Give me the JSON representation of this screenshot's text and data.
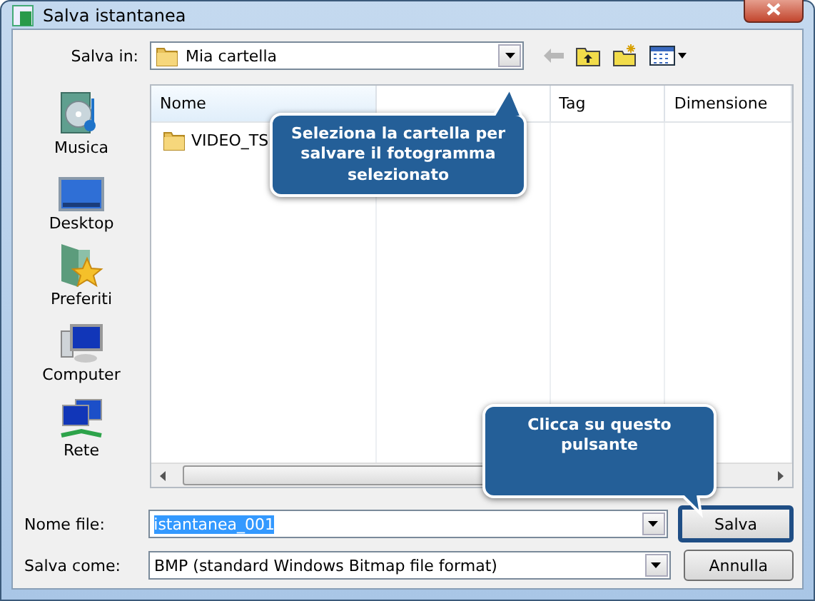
{
  "window": {
    "title": "Salva istantanea"
  },
  "save_in": {
    "label": "Salva in:",
    "value": "Mia cartella"
  },
  "places": [
    {
      "label": "Musica",
      "kind": "music"
    },
    {
      "label": "Desktop",
      "kind": "desktop"
    },
    {
      "label": "Preferiti",
      "kind": "favorites"
    },
    {
      "label": "Computer",
      "kind": "computer"
    },
    {
      "label": "Rete",
      "kind": "network"
    }
  ],
  "table": {
    "columns": [
      "Nome",
      "",
      "Tag",
      "Dimensione"
    ],
    "rows": [
      {
        "name": "VIDEO_TS",
        "selected": false
      }
    ]
  },
  "file_name": {
    "label": "Nome file:",
    "value": "istantanea_001"
  },
  "save_as": {
    "label": "Salva come:",
    "value": "BMP (standard Windows Bitmap file format)"
  },
  "buttons": [
    {
      "label": "Salva",
      "highlighted": true
    },
    {
      "label": "Annulla",
      "highlighted": false
    }
  ],
  "callouts": [
    {
      "text": "Seleziona la cartella per salvare il fotogramma selezionato"
    },
    {
      "text": "Clicca su questo pulsante"
    }
  ]
}
